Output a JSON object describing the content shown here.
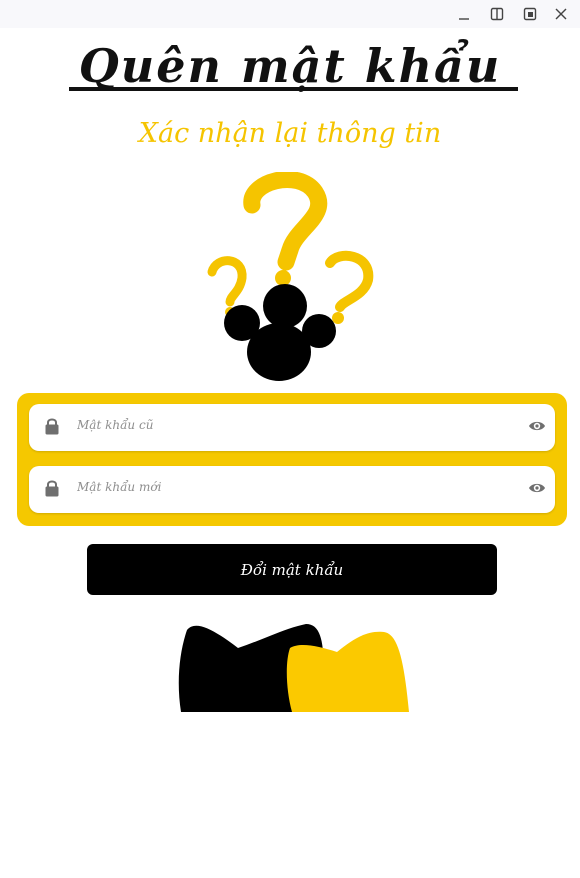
{
  "window": {
    "controls": [
      {
        "icon": "minimize-icon"
      },
      {
        "icon": "split-view-icon"
      },
      {
        "icon": "maximize-icon"
      },
      {
        "icon": "close-icon"
      }
    ]
  },
  "header": {
    "title": "Quên mật khẩu",
    "subtitle": "Xác nhận lại thông tin"
  },
  "illustration": {
    "icon": "paw-question-marks-illustration",
    "colors": {
      "question_marks": "#f5c400",
      "paw": "#000000"
    }
  },
  "form": {
    "old_password": {
      "value": "",
      "placeholder": "Mật khẩu cũ",
      "lead_icon": "lock-icon",
      "trail_icon": "eye-icon"
    },
    "new_password": {
      "value": "",
      "placeholder": "Mật khẩu mới",
      "lead_icon": "lock-icon",
      "trail_icon": "eye-icon"
    },
    "panel_color": "#f5c800"
  },
  "actions": {
    "submit_label": "Đổi mật khẩu"
  },
  "footer_art": {
    "icon": "cat-ears-illustration",
    "colors": {
      "black_cat": "#000000",
      "yellow_cat": "#fbc900"
    }
  }
}
